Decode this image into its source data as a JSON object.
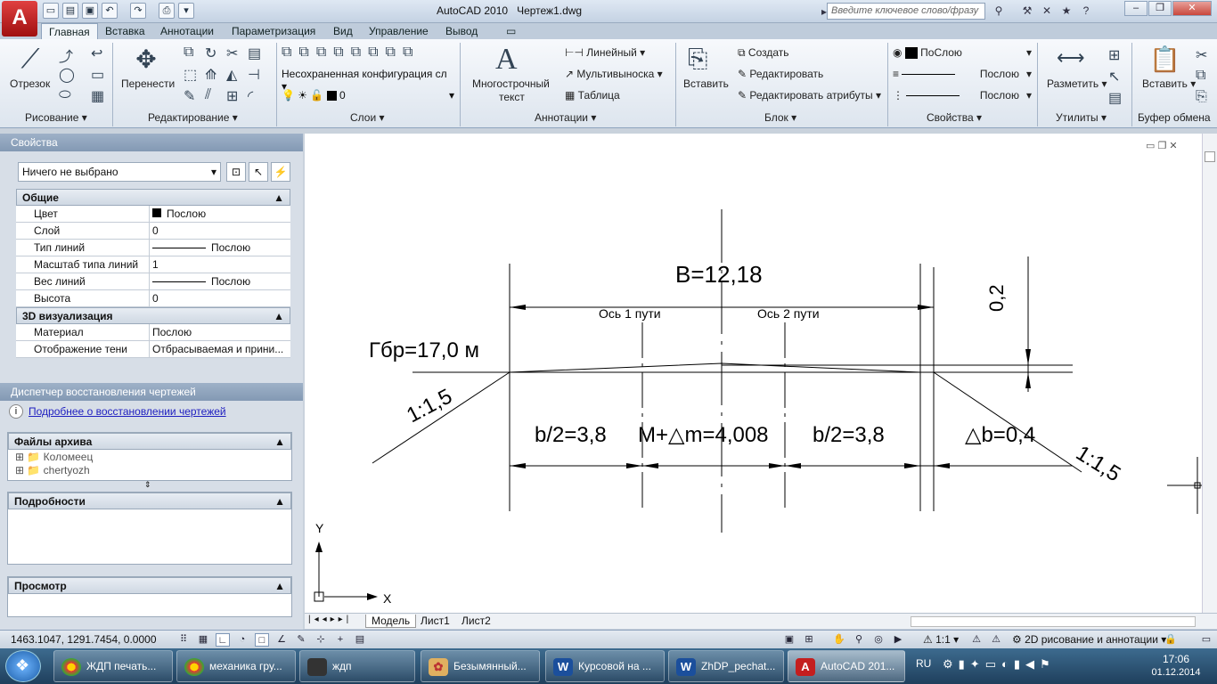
{
  "window": {
    "app_title": "AutoCAD 2010",
    "doc_title": "Чертеж1.dwg",
    "search_placeholder": "Введите ключевое слово/фразу"
  },
  "ribbon_tabs": [
    "Главная",
    "Вставка",
    "Аннотации",
    "Параметризация",
    "Вид",
    "Управление",
    "Вывод"
  ],
  "ribbon": {
    "draw": {
      "panel": "Рисование",
      "line": "Отрезок"
    },
    "modify": {
      "panel": "Редактирование",
      "move": "Перенести"
    },
    "layers": {
      "panel": "Слои",
      "config": "Несохраненная конфигурация сл",
      "current": "0"
    },
    "annotations": {
      "panel": "Аннотации",
      "mtext_1": "Многострочный",
      "mtext_2": "текст",
      "linear": "Линейный",
      "multileader": "Мультивыноска",
      "table": "Таблица"
    },
    "block": {
      "panel": "Блок",
      "insert": "Вставить",
      "create": "Создать",
      "edit": "Редактировать",
      "edit_attr": "Редактировать атрибуты"
    },
    "properties": {
      "panel": "Свойства",
      "color": "ПоСлою",
      "linetype": "Послою",
      "lineweight": "Послою"
    },
    "utilities": {
      "panel": "Утилиты",
      "measure": "Разметить"
    },
    "clipboard": {
      "panel": "Буфер обмена",
      "paste": "Вставить"
    }
  },
  "properties_palette": {
    "title": "Свойства",
    "selection": "Ничего не выбрано",
    "general": {
      "header": "Общие",
      "rows": [
        {
          "key": "Цвет",
          "value": "Послою"
        },
        {
          "key": "Слой",
          "value": "0"
        },
        {
          "key": "Тип линий",
          "value": "Послою"
        },
        {
          "key": "Масштаб типа линий",
          "value": "1"
        },
        {
          "key": "Вес линий",
          "value": "Послою"
        },
        {
          "key": "Высота",
          "value": "0"
        }
      ]
    },
    "viz3d": {
      "header": "3D визуализация",
      "rows": [
        {
          "key": "Материал",
          "value": "Послою"
        },
        {
          "key": "Отображение тени",
          "value": "Отбрасываемая и прини..."
        }
      ]
    }
  },
  "recovery": {
    "title": "Диспетчер восстановления чертежей",
    "link": "Подробнее о восстановлении чертежей",
    "files_header": "Файлы архива",
    "files": [
      "Коломеец",
      "chertyozh"
    ],
    "details_header": "Подробности",
    "preview_header": "Просмотр"
  },
  "drawing": {
    "B": "B=12,18",
    "axis1": "Ось 1 пути",
    "axis2": "Ось 2 пути",
    "gbr": "Гбр=17,0 м",
    "slope_left": "1:1,5",
    "slope_right": "1:1,5",
    "d02": "0,2",
    "b2_left": "b/2=3,8",
    "m": "M+△m=4,008",
    "b2_right": "b/2=3,8",
    "db": "△b=0,4",
    "ucs_x": "X",
    "ucs_y": "Y"
  },
  "layout_tabs": [
    "Модель",
    "Лист1",
    "Лист2"
  ],
  "status": {
    "coords": "1463.1047, 1291.7454, 0.0000",
    "scale": "1:1",
    "workspace": "2D рисование и аннотации"
  },
  "taskbar": {
    "items": [
      {
        "label": "ЖДП печать...",
        "icon": "chrome-icon"
      },
      {
        "label": "механика гру...",
        "icon": "chrome-icon"
      },
      {
        "label": "ждп",
        "icon": "folder-icon"
      },
      {
        "label": "Безымянный...",
        "icon": "paint-icon"
      },
      {
        "label": "Курсовой на ...",
        "icon": "word-icon"
      },
      {
        "label": "ZhDP_pechat...",
        "icon": "word-icon"
      },
      {
        "label": "AutoCAD 201...",
        "icon": "autocad-icon"
      }
    ],
    "lang": "RU",
    "time": "17:06",
    "date": "01.12.2014"
  },
  "colors": {
    "accent": "#c41e1e",
    "taskbar": "#1f3f5c",
    "ribbon": "#dde5ee"
  }
}
